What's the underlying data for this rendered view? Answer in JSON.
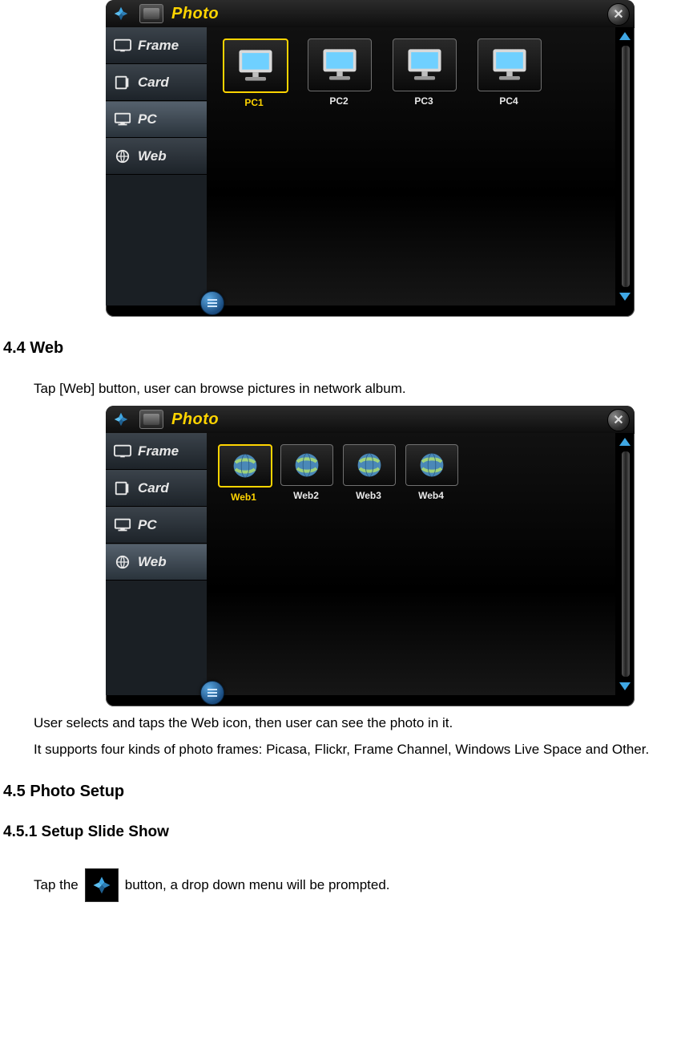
{
  "screenshots": {
    "pc": {
      "title": "Photo",
      "sidebar": [
        {
          "name": "frame",
          "label": "Frame",
          "selected": false
        },
        {
          "name": "card",
          "label": "Card",
          "selected": false
        },
        {
          "name": "pc",
          "label": "PC",
          "selected": true
        },
        {
          "name": "web",
          "label": "Web",
          "selected": false
        }
      ],
      "thumbs": [
        {
          "label": "PC1",
          "selected": true
        },
        {
          "label": "PC2",
          "selected": false
        },
        {
          "label": "PC3",
          "selected": false
        },
        {
          "label": "PC4",
          "selected": false
        }
      ]
    },
    "web": {
      "title": "Photo",
      "sidebar": [
        {
          "name": "frame",
          "label": "Frame",
          "selected": false
        },
        {
          "name": "card",
          "label": "Card",
          "selected": false
        },
        {
          "name": "pc",
          "label": "PC",
          "selected": false
        },
        {
          "name": "web",
          "label": "Web",
          "selected": true
        }
      ],
      "thumbs": [
        {
          "label": "Web1",
          "selected": true
        },
        {
          "label": "Web2",
          "selected": false
        },
        {
          "label": "Web3",
          "selected": false
        },
        {
          "label": "Web4",
          "selected": false
        }
      ]
    }
  },
  "sections": {
    "s44_title": "4.4 Web",
    "s44_p1": "Tap [Web] button, user can browse pictures in network album.",
    "s44_p2": "User selects and taps the Web icon, then user can see the photo in it.",
    "s44_p3": "It supports four kinds of photo frames: Picasa, Flickr, Frame Channel, Windows Live Space and Other.",
    "s45_title": "4.5 Photo Setup",
    "s451_title": "4.5.1 Setup Slide Show",
    "s451_before": "Tap the",
    "s451_after": "button, a drop down menu will be prompted."
  }
}
